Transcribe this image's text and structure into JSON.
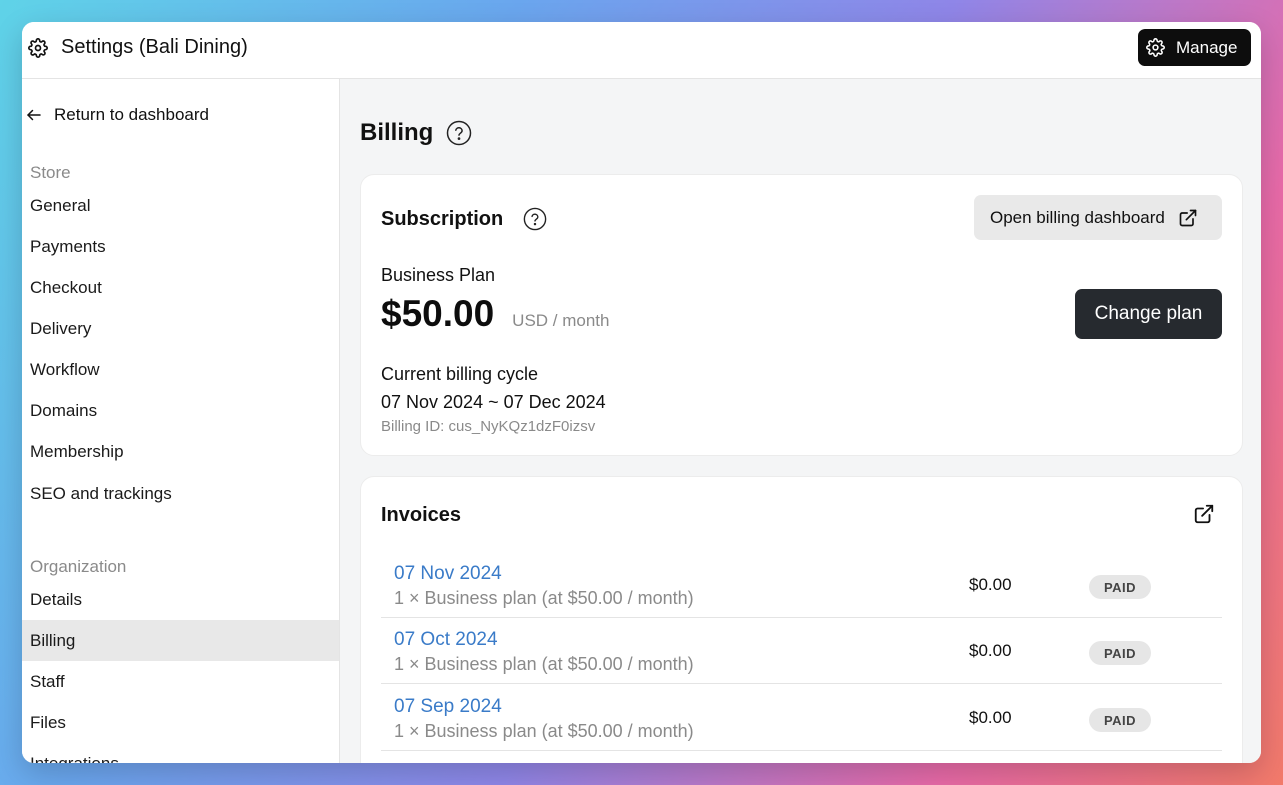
{
  "header": {
    "title": "Settings (Bali Dining)",
    "manage_label": "Manage"
  },
  "sidebar": {
    "return_label": "Return to dashboard",
    "store_heading": "Store",
    "store_items": [
      "General",
      "Payments",
      "Checkout",
      "Delivery",
      "Workflow",
      "Domains",
      "Membership",
      "SEO and trackings"
    ],
    "org_heading": "Organization",
    "org_items": [
      "Details",
      "Billing",
      "Staff",
      "Files",
      "Integrations"
    ],
    "active_item": "Billing"
  },
  "main": {
    "page_title": "Billing",
    "subscription": {
      "title": "Subscription",
      "open_billing_label": "Open billing dashboard",
      "plan_name": "Business Plan",
      "price": "$50.00",
      "period": "USD / month",
      "change_plan_label": "Change plan",
      "cycle_label": "Current billing cycle",
      "cycle_dates": "07 Nov 2024 ~ 07 Dec 2024",
      "billing_id": "Billing ID: cus_NyKQz1dzF0izsv"
    },
    "invoices": {
      "title": "Invoices",
      "rows": [
        {
          "date": "07 Nov 2024",
          "desc": "1 × Business plan (at $50.00 / month)",
          "amount": "$0.00",
          "status": "PAID"
        },
        {
          "date": "07 Oct 2024",
          "desc": "1 × Business plan (at $50.00 / month)",
          "amount": "$0.00",
          "status": "PAID"
        },
        {
          "date": "07 Sep 2024",
          "desc": "1 × Business plan (at $50.00 / month)",
          "amount": "$0.00",
          "status": "PAID"
        }
      ]
    }
  },
  "colors": {
    "link": "#3a7bc8",
    "muted": "#8a8a8a",
    "active_bg": "#e8e8e8",
    "dark_button": "#262a2f"
  }
}
